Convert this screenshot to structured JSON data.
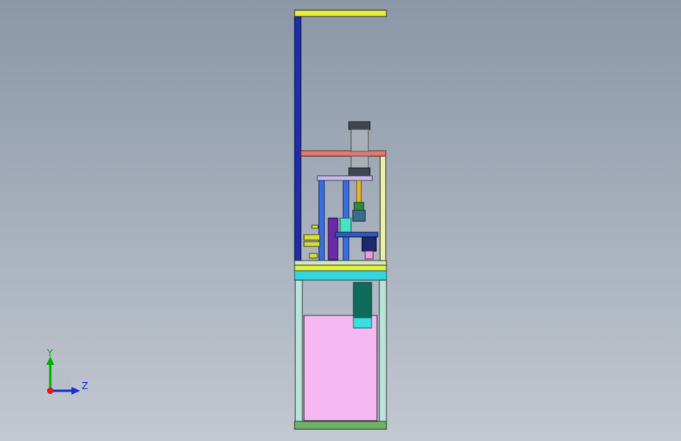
{
  "viewport": {
    "background_top": "#8b97a7",
    "background_bottom": "#c3c8d0"
  },
  "triad": {
    "y_label": "Y",
    "z_label": "Z",
    "y_color": "#00b000",
    "z_color": "#1a2fd6",
    "x_color": "#d81b1b"
  },
  "model": {
    "frame_color": "#b9e4dc",
    "mast_color": "#1d2ea8",
    "top_plate_color": "#e6ef3a",
    "head_plate_color": "#e07a72",
    "cylinder_color": "#aab0b8",
    "bin_color": "#f5b8f2",
    "chute_color": "#0f6b5a",
    "chute_tip_color": "#38e0e0",
    "base_color": "#6fb06a",
    "guide_color": "#3a6ee0",
    "block_color": "#6a2aa8"
  }
}
